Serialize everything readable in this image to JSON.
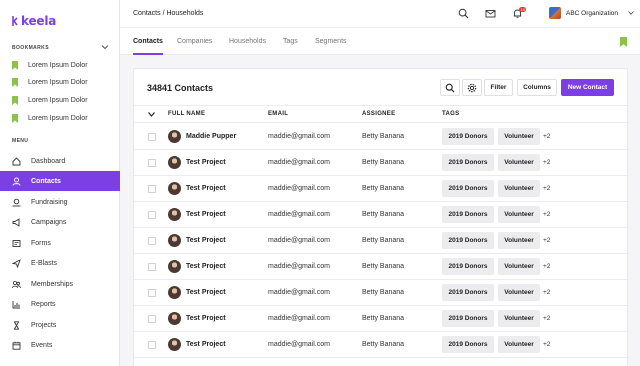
{
  "app": {
    "logo_text": "keela",
    "brand_color": "#7b3fe4"
  },
  "sidebar": {
    "bookmarks_label": "BOOKMARKS",
    "bookmarks": [
      "Lorem Ipsum Dolor",
      "Lorem Ipsum Dolor",
      "Lorem Ipsum Dolor",
      "Lorem Ipsum Dolor"
    ],
    "menu_label": "MENU",
    "menu": [
      {
        "label": "Dashboard",
        "icon": "home-icon",
        "active": false
      },
      {
        "label": "Contacts",
        "icon": "user-icon",
        "active": true
      },
      {
        "label": "Fundraising",
        "icon": "donation-icon",
        "active": false
      },
      {
        "label": "Campaigns",
        "icon": "megaphone-icon",
        "active": false
      },
      {
        "label": "Forms",
        "icon": "form-icon",
        "active": false
      },
      {
        "label": "E-Blasts",
        "icon": "send-icon",
        "active": false
      },
      {
        "label": "Memberships",
        "icon": "membership-icon",
        "active": false
      },
      {
        "label": "Reports",
        "icon": "chart-icon",
        "active": false
      },
      {
        "label": "Projects",
        "icon": "hourglass-icon",
        "active": false
      },
      {
        "label": "Events",
        "icon": "calendar-icon",
        "active": false
      }
    ]
  },
  "header": {
    "breadcrumb": "Contacts / Households",
    "notification_count": "10",
    "org_name": "ABC Organization"
  },
  "tabs": [
    "Contacts",
    "Companies",
    "Households",
    "Tags",
    "Segments"
  ],
  "main": {
    "title": "34841 Contacts",
    "filter_label": "Filter",
    "columns_label": "Columns",
    "new_contact_label": "New Contact",
    "columns": [
      "FULL NAME",
      "EMAIL",
      "ASSIGNEE",
      "TAGS"
    ],
    "rows": [
      {
        "name": "Maddie Pupper",
        "email": "maddie@gmail.com",
        "assignee": "Betty Banana",
        "tag1": "2019 Donors",
        "tag2": "Volunteer",
        "more": "+2"
      },
      {
        "name": "Test Project",
        "email": "maddie@gmail.com",
        "assignee": "Betty Banana",
        "tag1": "2019 Donors",
        "tag2": "Volunteer",
        "more": "+2"
      },
      {
        "name": "Test Project",
        "email": "maddie@gmail.com",
        "assignee": "Betty Banana",
        "tag1": "2019 Donors",
        "tag2": "Volunteer",
        "more": "+2"
      },
      {
        "name": "Test Project",
        "email": "maddie@gmail.com",
        "assignee": "Betty Banana",
        "tag1": "2019 Donors",
        "tag2": "Volunteer",
        "more": "+2"
      },
      {
        "name": "Test Project",
        "email": "maddie@gmail.com",
        "assignee": "Betty Banana",
        "tag1": "2019 Donors",
        "tag2": "Volunteer",
        "more": "+2"
      },
      {
        "name": "Test Project",
        "email": "maddie@gmail.com",
        "assignee": "Betty Banana",
        "tag1": "2019 Donors",
        "tag2": "Volunteer",
        "more": "+2"
      },
      {
        "name": "Test Project",
        "email": "maddie@gmail.com",
        "assignee": "Betty Banana",
        "tag1": "2019 Donors",
        "tag2": "Volunteer",
        "more": "+2"
      },
      {
        "name": "Test Project",
        "email": "maddie@gmail.com",
        "assignee": "Betty Banana",
        "tag1": "2019 Donors",
        "tag2": "Volunteer",
        "more": "+2"
      },
      {
        "name": "Test Project",
        "email": "maddie@gmail.com",
        "assignee": "Betty Banana",
        "tag1": "2019 Donors",
        "tag2": "Volunteer",
        "more": "+2"
      }
    ]
  }
}
